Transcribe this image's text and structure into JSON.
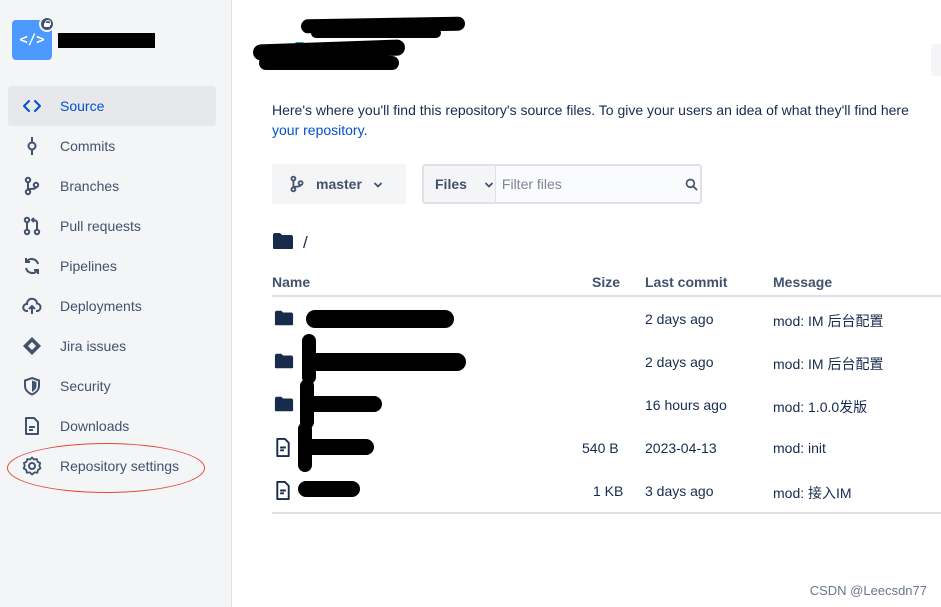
{
  "repo": {
    "avatar_icon": "code-icon",
    "avatar_glyph": "</>",
    "is_private": true
  },
  "sidebar": {
    "items": [
      {
        "label": "Source",
        "icon": "code-icon",
        "active": true
      },
      {
        "label": "Commits",
        "icon": "commit-icon"
      },
      {
        "label": "Branches",
        "icon": "branch-icon"
      },
      {
        "label": "Pull requests",
        "icon": "pull-request-icon"
      },
      {
        "label": "Pipelines",
        "icon": "pipelines-icon"
      },
      {
        "label": "Deployments",
        "icon": "cloud-upload-icon"
      },
      {
        "label": "Jira issues",
        "icon": "jira-icon"
      },
      {
        "label": "Security",
        "icon": "shield-icon"
      },
      {
        "label": "Downloads",
        "icon": "download-file-icon"
      },
      {
        "label": "Repository settings",
        "icon": "gear-icon"
      }
    ],
    "annotation_color": "#e34a3a"
  },
  "main": {
    "intro_text": "Here's where you'll find this repository's source files. To give your users an idea of what they'll find here",
    "intro_link": "your repository",
    "intro_suffix": ".",
    "branch": {
      "label": "master",
      "icon": "branch-icon"
    },
    "filter": {
      "type_label": "Files",
      "placeholder": "Filter files"
    },
    "path": "/",
    "table": {
      "headers": {
        "name": "Name",
        "size": "Size",
        "last_commit": "Last commit",
        "message": "Message"
      },
      "rows": [
        {
          "type": "folder",
          "size": "",
          "last_commit": "2 days ago",
          "message": "mod: IM 后台配置"
        },
        {
          "type": "folder",
          "size": "",
          "last_commit": "2 days ago",
          "message": "mod: IM 后台配置"
        },
        {
          "type": "folder",
          "size": "",
          "last_commit": "16 hours ago",
          "message": "mod: 1.0.0发版"
        },
        {
          "type": "file",
          "size": "540 B",
          "last_commit": "2023-04-13",
          "message": "mod: init"
        },
        {
          "type": "file",
          "size": "1 KB",
          "last_commit": "3 days ago",
          "message": "mod: 接入IM"
        }
      ]
    }
  },
  "watermark": "CSDN @Leecsdn77",
  "colors": {
    "accent": "#0052cc",
    "sidebar_bg": "#f4f5f7",
    "text": "#172b4d",
    "muted": "#42526e"
  }
}
